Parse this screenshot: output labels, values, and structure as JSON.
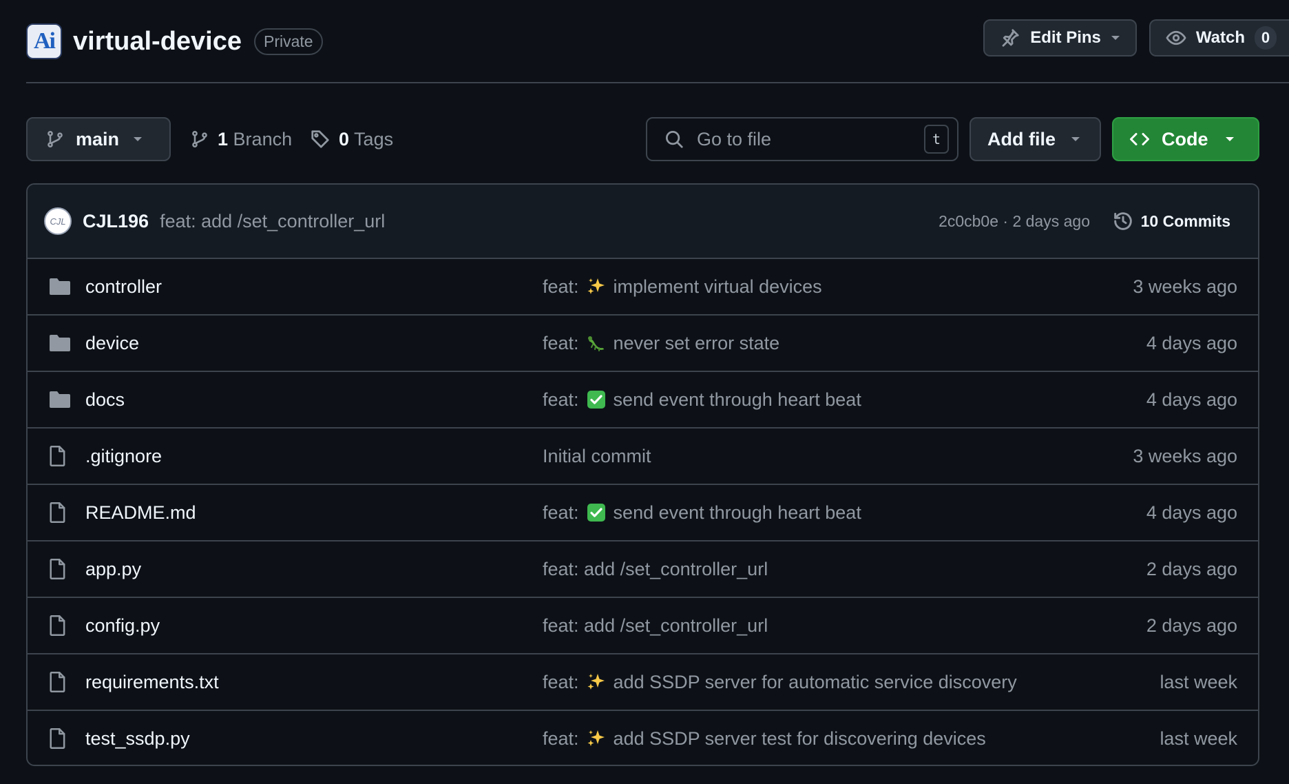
{
  "repo": {
    "logo_text": "Ai",
    "name": "virtual-device",
    "visibility": "Private",
    "edit_pins_label": "Edit Pins",
    "watch_label": "Watch",
    "watch_count": "0"
  },
  "toolbar": {
    "branch": "main",
    "branches_count": "1",
    "branches_label": "Branch",
    "tags_count": "0",
    "tags_label": "Tags",
    "search_placeholder": "Go to file",
    "search_shortcut": "t",
    "add_file_label": "Add file",
    "code_label": "Code",
    "code_color": "#238636"
  },
  "latest_commit": {
    "avatar_text": "CJL",
    "author": "CJL196",
    "message": "feat: add /set_controller_url",
    "meta": "2c0cb0e · 2 days ago",
    "commits_label": "10 Commits"
  },
  "files": [
    {
      "type": "folder",
      "name": "controller",
      "msg_prefix": "feat:",
      "emoji": "sparkles",
      "msg": "implement virtual devices",
      "time": "3 weeks ago"
    },
    {
      "type": "folder",
      "name": "device",
      "msg_prefix": "feat:",
      "emoji": "bug",
      "msg": "never set error state",
      "time": "4 days ago"
    },
    {
      "type": "folder",
      "name": "docs",
      "msg_prefix": "feat:",
      "emoji": "check",
      "msg": "send event through heart beat",
      "time": "4 days ago"
    },
    {
      "type": "file",
      "name": ".gitignore",
      "msg_prefix": "",
      "emoji": "",
      "msg": "Initial commit",
      "time": "3 weeks ago"
    },
    {
      "type": "file",
      "name": "README.md",
      "msg_prefix": "feat:",
      "emoji": "check",
      "msg": "send event through heart beat",
      "time": "4 days ago"
    },
    {
      "type": "file",
      "name": "app.py",
      "msg_prefix": "",
      "emoji": "",
      "msg": "feat: add /set_controller_url",
      "time": "2 days ago"
    },
    {
      "type": "file",
      "name": "config.py",
      "msg_prefix": "",
      "emoji": "",
      "msg": "feat: add /set_controller_url",
      "time": "2 days ago"
    },
    {
      "type": "file",
      "name": "requirements.txt",
      "msg_prefix": "feat:",
      "emoji": "sparkles",
      "msg": "add SSDP server for automatic service discovery",
      "time": "last week"
    },
    {
      "type": "file",
      "name": "test_ssdp.py",
      "msg_prefix": "feat:",
      "emoji": "sparkles",
      "msg": "add SSDP server test for discovering devices",
      "time": "last week"
    }
  ]
}
